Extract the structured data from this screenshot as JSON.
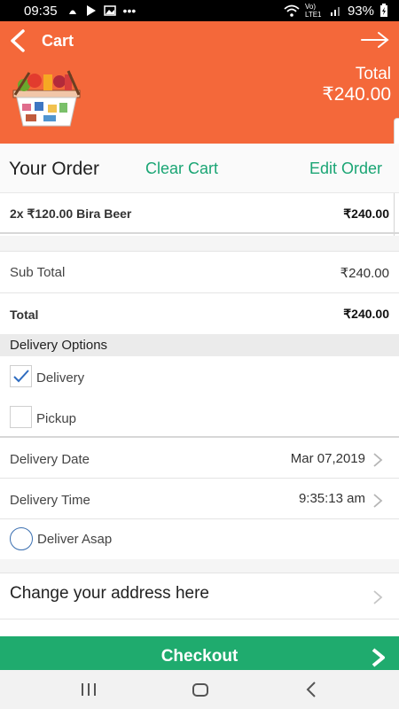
{
  "status_bar": {
    "time": "09:35",
    "more": "•••",
    "network": "Vo) LTE1",
    "battery": "93%"
  },
  "header": {
    "title": "Cart",
    "total_label": "Total",
    "total_amount": "₹240.00",
    "color": "#f4683a",
    "icons": [
      "back-arrow-icon",
      "forward-arrow-icon",
      "basket-image"
    ]
  },
  "order_bar": {
    "title": "Your Order",
    "clear_cart": "Clear Cart",
    "edit_order": "Edit Order",
    "accent": "#1aa574"
  },
  "items": [
    {
      "name": "2x ₹120.00 Bira Beer",
      "price": "₹240.00"
    }
  ],
  "summary": {
    "subtotal_label": "Sub Total",
    "subtotal_value": "₹240.00",
    "total_label": "Total",
    "total_value": "₹240.00"
  },
  "delivery_options": {
    "header": "Delivery Options",
    "options": [
      {
        "label": "Delivery",
        "checked": true
      },
      {
        "label": "Pickup",
        "checked": false
      }
    ]
  },
  "schedule": {
    "date_label": "Delivery Date",
    "date_value": "Mar 07,2019",
    "time_label": "Delivery Time",
    "time_value": "9:35:13 am",
    "asap_label": "Deliver Asap",
    "asap_selected": false
  },
  "address": {
    "label": "Change your address here"
  },
  "checkout": {
    "label": "Checkout",
    "color": "#1fab6e"
  },
  "nav": {
    "icons": [
      "recent-apps-icon",
      "home-icon",
      "back-icon"
    ]
  }
}
